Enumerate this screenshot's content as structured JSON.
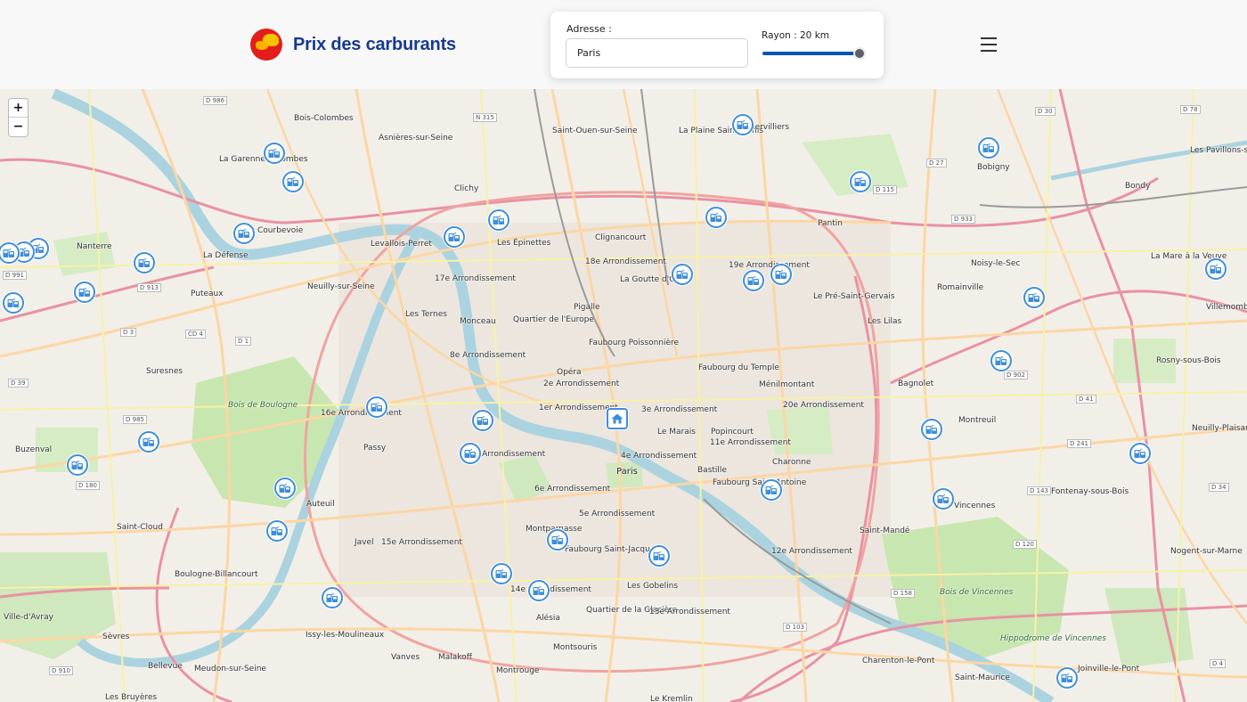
{
  "header": {
    "app_title": "Prix des carburants",
    "logo_icon": "fuel-brand-logo"
  },
  "search": {
    "address_label": "Adresse :",
    "address_value": "Paris",
    "radius_label": "Rayon : 20 km",
    "radius_level_fraction": 0.95
  },
  "menu": {
    "icon": "hamburger-menu-icon"
  },
  "map": {
    "zoom_in_label": "+",
    "zoom_out_label": "−",
    "place_names": [
      "Bois-Colombes",
      "Asnières-sur-Seine",
      "Saint-Ouen-sur-Seine",
      "La Plaine Saint-Denis",
      "Aubervilliers",
      "Bobigny",
      "Les Pavillons-sous-Bois",
      "La Garenne-Colombes",
      "Clichy",
      "Pantin",
      "Bondy",
      "Courbevoie",
      "Levallois-Perret",
      "Les Épinettes",
      "Clignancourt",
      "Nanterre",
      "La Défense",
      "17e Arrondissement",
      "18e Arrondissement",
      "La Goutte d'Or",
      "19e Arrondissement",
      "Noisy-le-Sec",
      "La Mare à la Veuve",
      "Puteaux",
      "Neuilly-sur-Seine",
      "Les Ternes",
      "Monceau",
      "Quartier de l'Europe",
      "Pigalle",
      "Le Pré-Saint-Gervais",
      "Romainville",
      "Villemomble",
      "Les Lilas",
      "Faubourg Poissonnière",
      "8e Arrondissement",
      "Suresnes",
      "Opéra",
      "Faubourg du Temple",
      "Ménilmontant",
      "Bagnolet",
      "Rosny-sous-Bois",
      "2e Arrondissement",
      "1er Arrondissement",
      "3e Arrondissement",
      "16e Arrondissement",
      "Bois de Boulogne",
      "20e Arrondissement",
      "Montreuil",
      "Le Marais",
      "Popincourt",
      "11e Arrondissement",
      "Passy",
      "Buzenval",
      "Neuilly-Plaisance",
      "7e Arrondissement",
      "4e Arrondissement",
      "Paris",
      "Bastille",
      "Charonne",
      "6e Arrondissement",
      "Faubourg Saint-Antoine",
      "Fontenay-sous-Bois",
      "Auteuil",
      "5e Arrondissement",
      "Vincennes",
      "Saint-Cloud",
      "Montparnasse",
      "Saint-Mandé",
      "Javel",
      "15e Arrondissement",
      "Faubourg Saint-Jacques",
      "12e Arrondissement",
      "Nogent-sur-Marne",
      "Boulogne-Billancourt",
      "Les Gobelins",
      "14e Arrondissement",
      "Bois de Vincennes",
      "Alésia",
      "Quartier de la Glacière",
      "13e Arrondissement",
      "Ville-d'Avray",
      "Issy-les-Moulineaux",
      "Sèvres",
      "Vanves",
      "Malakoff",
      "Montsouris",
      "Hippodrome de Vincennes",
      "Bellevue",
      "Meudon-sur-Seine",
      "Montrouge",
      "Charenton-le-Pont",
      "Saint-Maurice",
      "Joinville-le-Pont",
      "Les Bruyères",
      "Le Kremlin"
    ],
    "road_badges": [
      "D 986",
      "N 315",
      "D 30",
      "D 78",
      "D 27",
      "D 115",
      "D 933",
      "D 991",
      "D 913",
      "D 3",
      "CD 4",
      "D 1",
      "D 39",
      "D 985",
      "D 902",
      "D 41",
      "D 241",
      "D 180",
      "D 143",
      "D 34",
      "D 120",
      "D 158",
      "D 103",
      "D 910",
      "D 4"
    ],
    "markers": [
      {
        "type": "fuel-station"
      },
      {
        "type": "fuel-station"
      },
      {
        "type": "fuel-station"
      },
      {
        "type": "fuel-station"
      },
      {
        "type": "fuel-station"
      },
      {
        "type": "fuel-station"
      },
      {
        "type": "fuel-station"
      },
      {
        "type": "fuel-station"
      },
      {
        "type": "fuel-station"
      },
      {
        "type": "fuel-station"
      },
      {
        "type": "fuel-station"
      },
      {
        "type": "fuel-station"
      },
      {
        "type": "fuel-station"
      },
      {
        "type": "fuel-station"
      },
      {
        "type": "fuel-station"
      },
      {
        "type": "fuel-station"
      },
      {
        "type": "fuel-station"
      },
      {
        "type": "fuel-station"
      },
      {
        "type": "fuel-station"
      },
      {
        "type": "fuel-station"
      },
      {
        "type": "fuel-station"
      },
      {
        "type": "fuel-station"
      },
      {
        "type": "fuel-station"
      },
      {
        "type": "fuel-station"
      },
      {
        "type": "fuel-station"
      },
      {
        "type": "fuel-station"
      },
      {
        "type": "fuel-station"
      },
      {
        "type": "fuel-station"
      },
      {
        "type": "fuel-station"
      },
      {
        "type": "fuel-station"
      },
      {
        "type": "fuel-station"
      },
      {
        "type": "fuel-station"
      },
      {
        "type": "fuel-station"
      },
      {
        "type": "fuel-station"
      },
      {
        "type": "fuel-station"
      },
      {
        "type": "fuel-station"
      },
      {
        "type": "fuel-station"
      },
      {
        "type": "fuel-station"
      },
      {
        "type": "home-location"
      }
    ]
  },
  "colors": {
    "brand_blue": "#173a8f",
    "marker_border": "#3f8ed8",
    "slider": "#0c55b8",
    "seine": "#aad3df",
    "park": "#c8e6b0",
    "motorway": "#e892a2",
    "primary_road": "#fcd6a4"
  }
}
